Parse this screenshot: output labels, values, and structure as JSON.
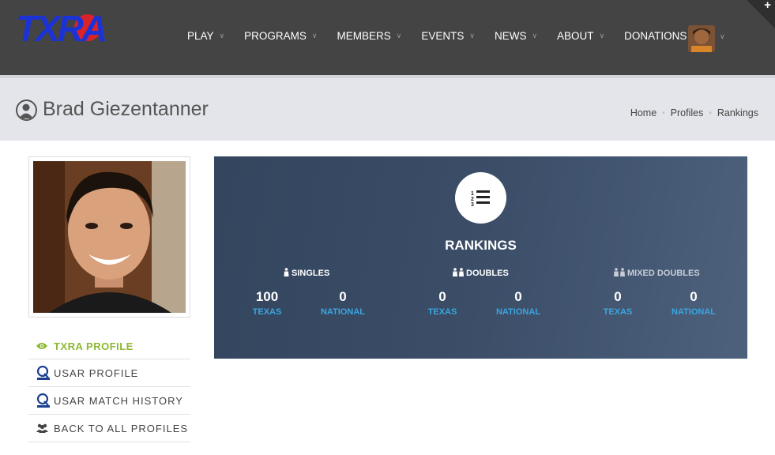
{
  "header": {
    "logo_text": "TXRA",
    "nav": [
      {
        "label": "PLAY",
        "caret": "∨"
      },
      {
        "label": "PROGRAMS",
        "caret": "∨"
      },
      {
        "label": "MEMBERS",
        "caret": "∨"
      },
      {
        "label": "EVENTS",
        "caret": "∨"
      },
      {
        "label": "NEWS",
        "caret": "∨"
      },
      {
        "label": "ABOUT",
        "caret": "∨"
      },
      {
        "label": "DONATIONS",
        "caret": ""
      }
    ],
    "avatar_caret": "∨",
    "corner_plus": "+"
  },
  "titlebar": {
    "title": "Brad Giezentanner",
    "breadcrumb": [
      "Home",
      "Profiles",
      "Rankings"
    ],
    "separator": "•"
  },
  "sidebar": {
    "items": [
      {
        "label": "TXRA PROFILE",
        "icon": "eye-icon"
      },
      {
        "label": "USAR PROFILE",
        "icon": "r-sports-logo-icon"
      },
      {
        "label": "USAR MATCH HISTORY",
        "icon": "r-sports-logo-icon"
      },
      {
        "label": "BACK TO ALL PROFILES",
        "icon": "users-icon"
      }
    ]
  },
  "rankings": {
    "title": "RANKINGS",
    "categories": [
      {
        "name": "SINGLES",
        "icon": "person-icon",
        "texas": "100",
        "national": "0"
      },
      {
        "name": "DOUBLES",
        "icon": "two-people-icon",
        "texas": "0",
        "national": "0"
      },
      {
        "name": "MIXED DOUBLES",
        "icon": "two-people-icon",
        "texas": "0",
        "national": "0"
      }
    ],
    "texas_label": "TEXAS",
    "national_label": "NATIONAL"
  },
  "colors": {
    "nav_bg": "#444444",
    "titlebar_bg": "#e4e5ea",
    "panel_bg": "#3b4d67",
    "active_green": "#8cb832",
    "link_blue": "#3aa6e0",
    "logo_blue": "#1b33d6",
    "logo_red": "#d9232a"
  }
}
